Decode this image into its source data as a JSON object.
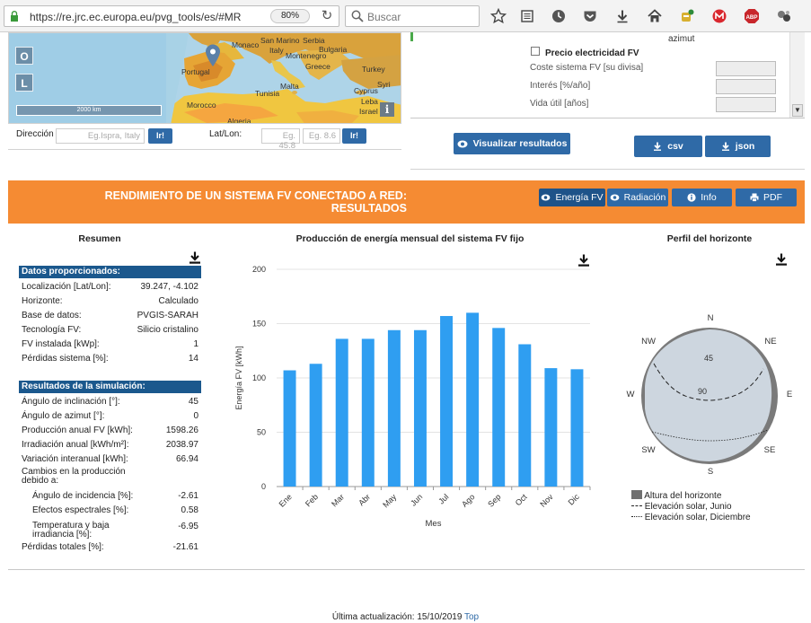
{
  "browser": {
    "url": "https://re.jrc.ec.europa.eu/pvg_tools/es/#MR",
    "zoom": "80%",
    "search_placeholder": "Buscar"
  },
  "map": {
    "buttons": [
      "O",
      "L"
    ],
    "labels": {
      "monaco": "Monaco",
      "san_marino": "San Marino",
      "serbia": "Serbia",
      "bulgaria": "Bulgaria",
      "italy": "Italy",
      "montenegro": "Montenegro",
      "portugal": "Portugal",
      "greece": "Greece",
      "turkey": "Turkey",
      "tunisia": "Tunisia",
      "malta": "Malta",
      "cyprus": "Cyprus",
      "syria": "Syri",
      "morocco": "Morocco",
      "lebanon": "Leba",
      "israel": "Israel",
      "algeria": "Algeria"
    },
    "scale": "2000 km",
    "info": "i"
  },
  "location": {
    "address_label": "Dirección",
    "address_placeholder": "Eg.Ispra, Italy",
    "go_label": "Ir!",
    "latlon_label": "Lat/Lon:",
    "lat_placeholder": "Eg. 45.8",
    "lon_placeholder": "Eg. 8.6"
  },
  "financial": {
    "azimut_fragment": "azimut",
    "price_checkbox_label": "Precio electricidad FV",
    "fields": [
      "Coste sistema FV [su divisa]",
      "Interés [%/año]",
      "Vida útil [años]"
    ]
  },
  "actions": {
    "visualize": "Visualizar resultados",
    "csv": "csv",
    "json": "json"
  },
  "results_header": {
    "title_line1": "RENDIMIENTO DE UN SISTEMA FV CONECTADO A RED:",
    "title_line2": "RESULTADOS",
    "tabs": [
      "Energía FV",
      "Radiación",
      "Info",
      "PDF"
    ]
  },
  "summary": {
    "title": "Resumen",
    "provided_header": "Datos proporcionados:",
    "provided": [
      {
        "k": "Localización [Lat/Lon]:",
        "v": "39.247, -4.102"
      },
      {
        "k": "Horizonte:",
        "v": "Calculado"
      },
      {
        "k": "Base de datos:",
        "v": "PVGIS-SARAH"
      },
      {
        "k": "Tecnología FV:",
        "v": "Silicio cristalino"
      },
      {
        "k": "FV instalada [kWp]:",
        "v": "1"
      },
      {
        "k": "Pérdidas sistema [%]:",
        "v": "14"
      }
    ],
    "results_header": "Resultados de la simulación:",
    "results": [
      {
        "k": "Ángulo de inclinación [°]:",
        "v": "45"
      },
      {
        "k": "Ángulo de azimut [°]:",
        "v": "0"
      },
      {
        "k": "Producción anual FV [kWh]:",
        "v": "1598.26"
      },
      {
        "k": "Irradiación anual [kWh/m²]:",
        "v": "2038.97"
      },
      {
        "k": "Variación interanual [kWh]:",
        "v": "66.94"
      }
    ],
    "changes_label": "Cambios en la producción debido a:",
    "changes": [
      {
        "k": "Ángulo de incidencia [%]:",
        "v": "-2.61"
      },
      {
        "k": "Efectos espectrales [%]:",
        "v": "0.58"
      },
      {
        "k": "Temperatura y baja irradiancia [%]:",
        "v": "-6.95"
      }
    ],
    "total": {
      "k": "Pérdidas totales [%]:",
      "v": "-21.61"
    }
  },
  "chart_data": {
    "type": "bar",
    "title": "Producción de energía mensual del sistema FV fijo",
    "xlabel": "Mes",
    "ylabel": "Energía FV [kWh]",
    "categories": [
      "Ene",
      "Feb",
      "Mar",
      "Abr",
      "May",
      "Jun",
      "Jul",
      "Ago",
      "Sep",
      "Oct",
      "Nov",
      "Dic"
    ],
    "values": [
      107,
      113,
      136,
      136,
      144,
      144,
      157,
      160,
      146,
      131,
      109,
      108
    ],
    "ylim": [
      0,
      200
    ],
    "yticks": [
      0,
      50,
      100,
      150,
      200
    ],
    "grid": true,
    "color": "#2f9ef1"
  },
  "horizon": {
    "title": "Perfil del horizonte",
    "compass": {
      "n": "N",
      "ne": "NE",
      "e": "E",
      "se": "SE",
      "s": "S",
      "sw": "SW",
      "w": "W",
      "nw": "NW"
    },
    "ring_labels": [
      "45",
      "90"
    ],
    "legend": [
      "Altura del horizonte",
      "Elevación solar, Junio",
      "Elevación solar, Diciembre"
    ]
  },
  "footer": {
    "updated": "Última actualización: 15/10/2019",
    "top": "Top"
  }
}
